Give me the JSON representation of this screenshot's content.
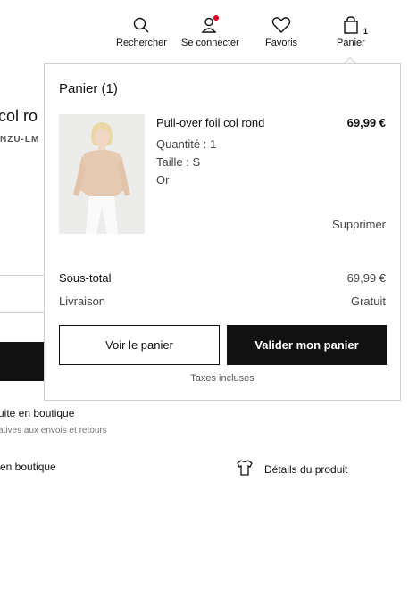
{
  "header": {
    "search_label": "Rechercher",
    "login_label": "Se connecter",
    "favorites_label": "Favoris",
    "cart_label": "Panier",
    "cart_count": "1",
    "notification_color": "#e0061f"
  },
  "background_page": {
    "product_title_partial": "col ro",
    "reference_partial": "NZU-LM",
    "pickup_title_partial": "uite en boutique",
    "pickup_sub_partial": "atives aux envois et retours",
    "store_partial": "en boutique",
    "details_label": "Détails du produit"
  },
  "cart_popup": {
    "title": "Panier (1)",
    "item": {
      "name": "Pull-over foil col rond",
      "price": "69,99 €",
      "quantity": "Quantité : 1",
      "size": "Taille : S",
      "color": "Or",
      "remove_label": "Supprimer"
    },
    "subtotal_label": "Sous-total",
    "subtotal_value": "69,99 €",
    "shipping_label": "Livraison",
    "shipping_value": "Gratuit",
    "view_cart_label": "Voir le panier",
    "checkout_label": "Valider mon panier",
    "taxes_note": "Taxes incluses"
  },
  "colors": {
    "primary_dark": "#111111",
    "border": "#cfcfcf"
  }
}
